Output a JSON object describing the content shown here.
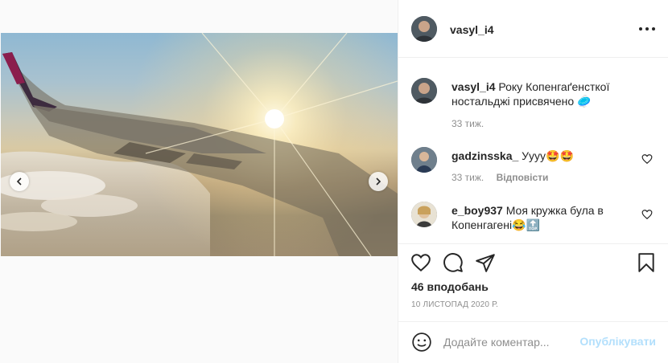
{
  "post": {
    "author": "vasyl_i4",
    "caption": "Року Копенгаґенсткої ностальджі присвячено 🥏",
    "caption_time": "33 тиж.",
    "likes": "46 вподобань",
    "date": "10 ЛИСТОПАД 2020 Р."
  },
  "comments": [
    {
      "user": "gadzinsska_",
      "text": "Ууyy🤩🤩",
      "time": "33 тиж.",
      "reply": "Відповісти"
    },
    {
      "user": "e_boy937",
      "text": "Моя кружка була в Копенгагені😂🔝"
    }
  ],
  "add_comment": {
    "placeholder": "Додайте коментар...",
    "post_label": "Опублікувати"
  },
  "icons": [
    "more-icon",
    "heart-icon",
    "comment-icon",
    "share-icon",
    "bookmark-icon",
    "emoji-icon",
    "chevron-left-icon",
    "chevron-right-icon"
  ]
}
